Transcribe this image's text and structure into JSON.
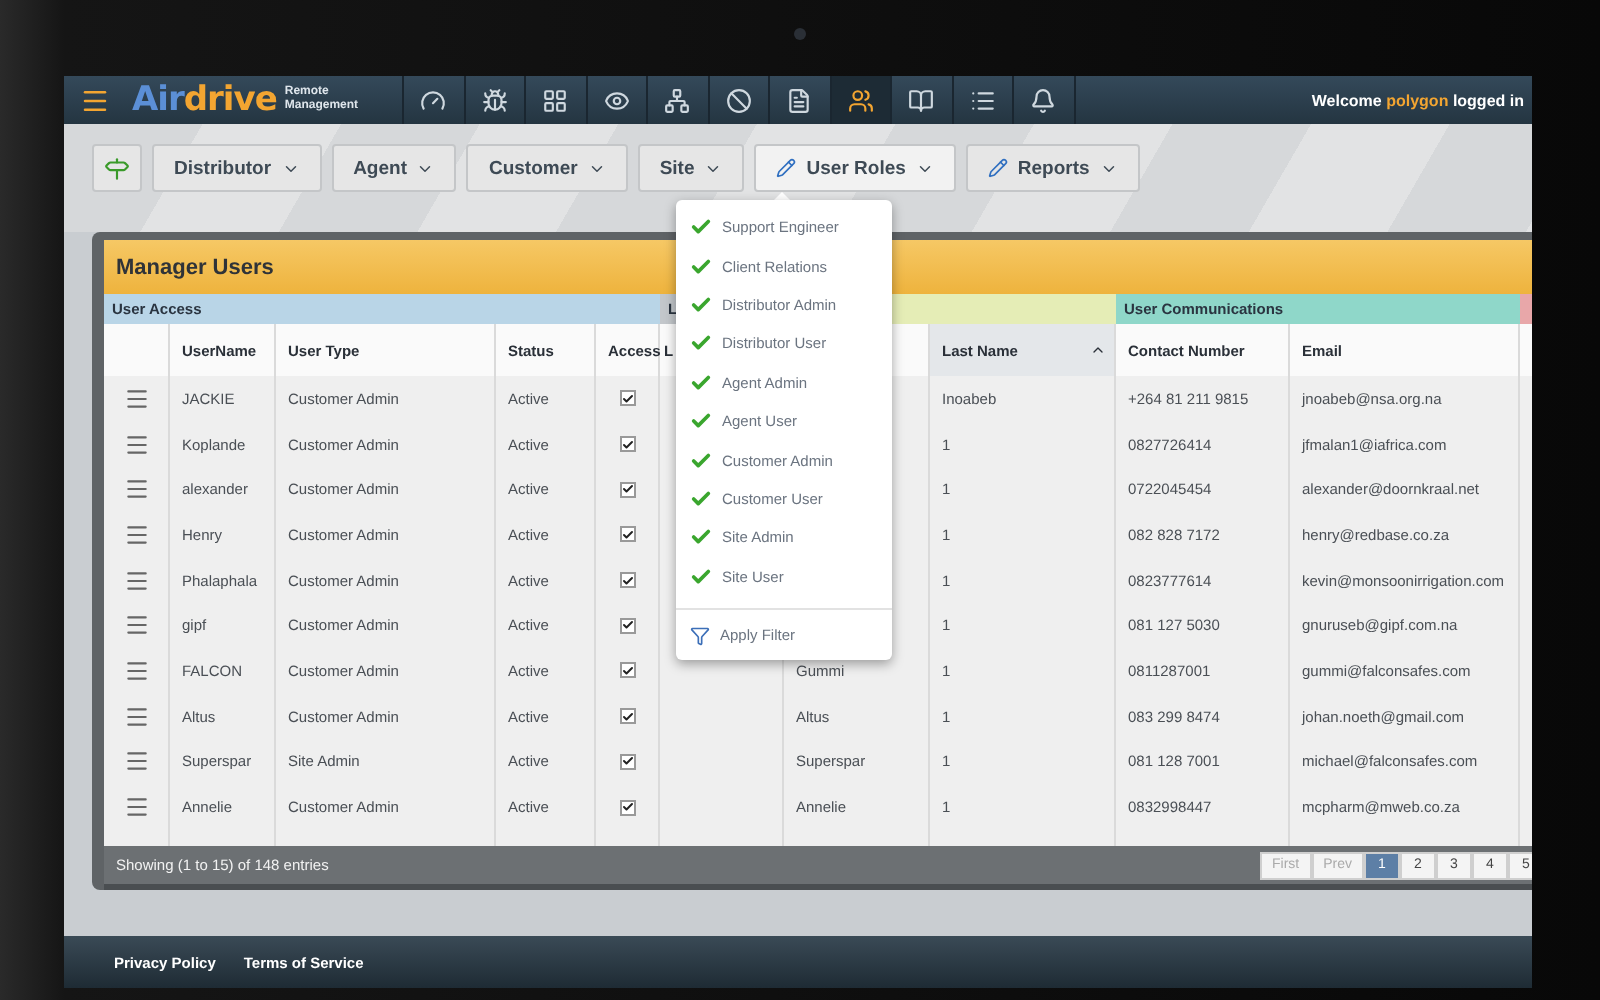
{
  "nav": {
    "logo": {
      "part_1": "Air",
      "part_2": "drive",
      "tagline": "Remote Management"
    },
    "items": [
      {
        "selected": false
      },
      {
        "selected": false
      },
      {
        "selected": false
      },
      {
        "selected": false
      },
      {
        "selected": false
      },
      {
        "selected": false
      },
      {
        "selected": false
      },
      {
        "selected": true
      },
      {
        "selected": false
      },
      {
        "selected": false
      },
      {
        "selected": false
      }
    ],
    "welcome": {
      "before": "Welcome",
      "user": "polygon",
      "after": "logged in"
    }
  },
  "toolbar": [
    {
      "kind": "filter",
      "expanded": false
    },
    {
      "kind": "plain",
      "label": "Distributor",
      "expanded": false
    },
    {
      "kind": "plain",
      "label": "Agent",
      "expanded": false
    },
    {
      "kind": "plain",
      "label": "Customer",
      "expanded": false
    },
    {
      "kind": "plain",
      "label": "Site",
      "expanded": false
    },
    {
      "kind": "edit",
      "label": "User Roles",
      "expanded": true
    },
    {
      "kind": "edit",
      "label": "Reports",
      "expanded": false
    }
  ],
  "menu": {
    "items": [
      {
        "label": "Support Engineer",
        "checked": true
      },
      {
        "label": "Client Relations",
        "checked": true
      },
      {
        "label": "Distributor Admin",
        "checked": true
      },
      {
        "label": "Distributor User",
        "checked": true
      },
      {
        "label": "Agent Admin",
        "checked": true
      },
      {
        "label": "Agent User",
        "checked": true
      },
      {
        "label": "Customer Admin",
        "checked": true
      },
      {
        "label": "Customer User",
        "checked": true
      },
      {
        "label": "Site Admin",
        "checked": true
      },
      {
        "label": "Site User",
        "checked": true
      }
    ],
    "action": "Apply Filter"
  },
  "panel": {
    "title": "Manager Users",
    "groups": [
      {
        "label": "User Access",
        "color": "#b9d5e7"
      },
      {
        "label": "L",
        "color": "#c3c7cb"
      },
      {
        "color": "#e5edb6"
      },
      {
        "label": "User Communications",
        "color": "#8fd7c9"
      }
    ],
    "columns": [
      {
        "sorted": false
      },
      {
        "label": "UserName",
        "sorted": false
      },
      {
        "label": "User Type",
        "sorted": false
      },
      {
        "label": "Status",
        "sorted": false
      },
      {
        "label": "Access",
        "sorted": false
      },
      {
        "label": "L",
        "sorted": false
      },
      {
        "sorted": false
      },
      {
        "label": "Last Name",
        "sorted": true
      },
      {
        "label": "Contact Number",
        "sorted": false
      },
      {
        "label": "Email",
        "sorted": false
      }
    ],
    "rows": [
      {
        "username": "JACKIE",
        "type": "Customer Admin",
        "status": "Active",
        "access": true,
        "last_name": "Inoabeb",
        "contact": "+264 81 211 9815",
        "email": "jnoabeb@nsa.org.na"
      },
      {
        "username": "Koplande",
        "type": "Customer Admin",
        "status": "Active",
        "access": true,
        "last_name": "1",
        "contact": "0827726414",
        "email": "jfmalan1@iafrica.com"
      },
      {
        "username": "alexander",
        "type": "Customer Admin",
        "status": "Active",
        "access": true,
        "last_name": "1",
        "contact": "0722045454",
        "email": "alexander@doornkraal.net"
      },
      {
        "username": "Henry",
        "type": "Customer Admin",
        "status": "Active",
        "access": true,
        "last_name": "1",
        "contact": "082 828 7172",
        "email": "henry@redbase.co.za"
      },
      {
        "username": "Phalaphala",
        "type": "Customer Admin",
        "status": "Active",
        "access": true,
        "last_name": "1",
        "contact": "0823777614",
        "email": "kevin@monsoonirrigation.com"
      },
      {
        "username": "gipf",
        "type": "Customer Admin",
        "status": "Active",
        "access": true,
        "last_name": "1",
        "contact": "081 127 5030",
        "email": "gnuruseb@gipf.com.na"
      },
      {
        "username": "FALCON",
        "type": "Customer Admin",
        "status": "Active",
        "access": true,
        "first_name": "Gummi",
        "last_name": "1",
        "contact": "0811287001",
        "email": "gummi@falconsafes.com"
      },
      {
        "username": "Altus",
        "type": "Customer Admin",
        "status": "Active",
        "access": true,
        "first_name": "Altus",
        "last_name": "1",
        "contact": "083 299 8474",
        "email": "johan.noeth@gmail.com"
      },
      {
        "username": "Superspar",
        "type": "Site Admin",
        "status": "Active",
        "access": true,
        "first_name": "Superspar",
        "last_name": "1",
        "contact": "081 128 7001",
        "email": "michael@falconsafes.com"
      },
      {
        "username": "Annelie",
        "type": "Customer Admin",
        "status": "Active",
        "access": true,
        "first_name": "Annelie",
        "last_name": "1",
        "contact": "0832998447",
        "email": "mcpharm@mweb.co.za"
      }
    ],
    "summary": "Showing (1 to 15) of 148 entries",
    "pages": [
      {
        "label": "First",
        "disabled": true,
        "selected": false
      },
      {
        "label": "Prev",
        "disabled": true,
        "selected": false
      },
      {
        "label": "1",
        "disabled": false,
        "selected": true
      },
      {
        "label": "2",
        "disabled": false,
        "selected": false
      },
      {
        "label": "3",
        "disabled": false,
        "selected": false
      },
      {
        "label": "4",
        "disabled": false,
        "selected": false
      },
      {
        "label": "5",
        "disabled": false,
        "selected": false
      }
    ]
  },
  "footer": [
    "Privacy Policy",
    "Terms of Service"
  ]
}
